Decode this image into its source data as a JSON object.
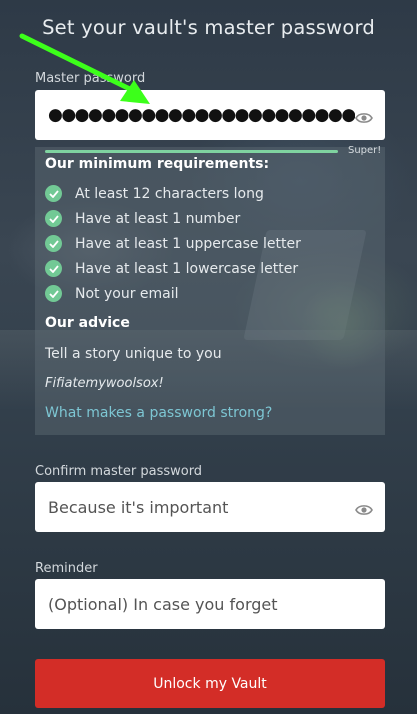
{
  "title": "Set your vault's master password",
  "master_password": {
    "label": "Master password",
    "masked_value": "●●●●●●●●●●●●●●●●●●●●●●●●",
    "eye_icon": "eye-icon"
  },
  "strength": {
    "label": "Super!",
    "level": 1.0,
    "color": "#7fd3a0"
  },
  "requirements": {
    "heading": "Our minimum requirements:",
    "items": [
      {
        "text": "At least 12 characters long",
        "met": true
      },
      {
        "text": "Have at least 1 number",
        "met": true
      },
      {
        "text": "Have at least 1 uppercase letter",
        "met": true
      },
      {
        "text": "Have at least 1 lowercase letter",
        "met": true
      },
      {
        "text": "Not your email",
        "met": true
      }
    ]
  },
  "advice": {
    "heading": "Our advice",
    "text": "Tell a story unique to you",
    "example": "Fifiatemywoolsox!",
    "link": "What makes a password strong?"
  },
  "confirm": {
    "label": "Confirm master password",
    "placeholder": "Because it's important"
  },
  "reminder": {
    "label": "Reminder",
    "placeholder": "(Optional) In case you forget"
  },
  "unlock_button": "Unlock my Vault",
  "colors": {
    "accent_red": "#d32d27",
    "check_green": "#72c995",
    "link_teal": "#7dc6d3",
    "annotation_arrow": "#3cff1a"
  }
}
